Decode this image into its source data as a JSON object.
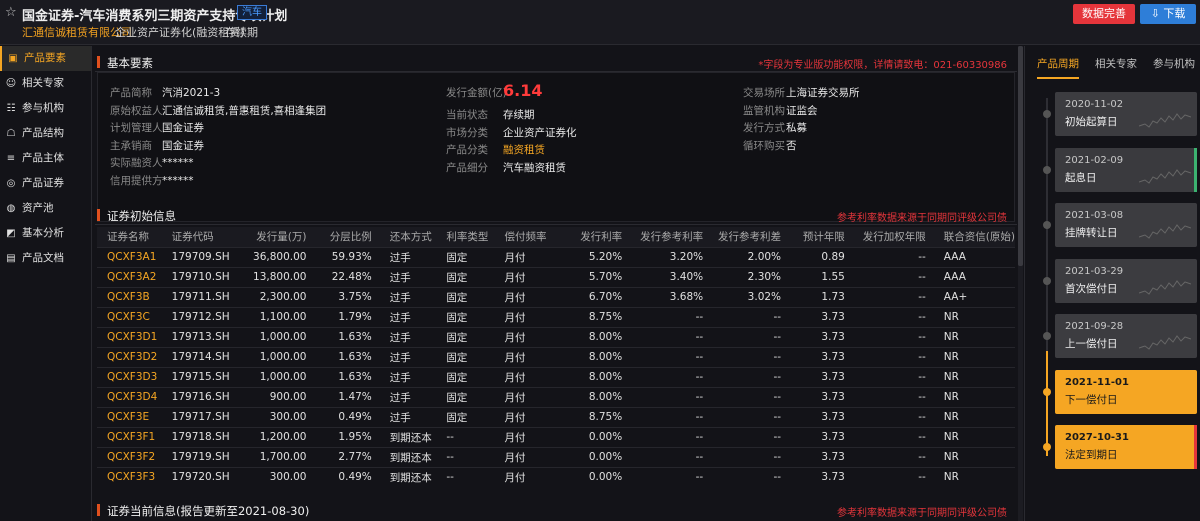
{
  "header": {
    "title": "国金证券-汽车消费系列三期资产支持专项计划",
    "tag": "汽车",
    "originator": "汇通信诚租赁有限公司",
    "type": "企业资产证券化(融资租赁)",
    "status": "存续期",
    "btn_data": "数据完善",
    "btn_download": "下载"
  },
  "sidebar": {
    "items": [
      {
        "label": "产品要素",
        "icon": "grid-icon"
      },
      {
        "label": "相关专家",
        "icon": "user-icon"
      },
      {
        "label": "参与机构",
        "icon": "people-icon"
      },
      {
        "label": "产品结构",
        "icon": "structure-icon"
      },
      {
        "label": "产品主体",
        "icon": "layers-icon"
      },
      {
        "label": "产品证券",
        "icon": "security-icon"
      },
      {
        "label": "资产池",
        "icon": "pool-icon"
      },
      {
        "label": "基本分析",
        "icon": "chart-icon"
      },
      {
        "label": "产品文档",
        "icon": "doc-icon"
      }
    ]
  },
  "basic": {
    "title": "基本要素",
    "note": "*字段为专业版功能权限，详情请致电：021-60330986",
    "col1": [
      {
        "k": "产品简称",
        "v": "汽消2021-3"
      },
      {
        "k": "原始权益人",
        "v": "汇通信诚租赁,普惠租赁,喜相逢集团"
      },
      {
        "k": "计划管理人",
        "v": "国金证券"
      },
      {
        "k": "主承销商",
        "v": "国金证券"
      },
      {
        "k": "实际融资人",
        "v": "******"
      },
      {
        "k": "信用提供方",
        "v": "******"
      }
    ],
    "col2": [
      {
        "k": "发行金额(亿)",
        "v": "6.14"
      },
      {
        "k": "当前状态",
        "v": "存续期"
      },
      {
        "k": "市场分类",
        "v": "企业资产证券化"
      },
      {
        "k": "产品分类",
        "v": "融资租赁"
      },
      {
        "k": "产品细分",
        "v": "汽车融资租赁"
      }
    ],
    "col3": [
      {
        "k": "交易场所",
        "v": "上海证券交易所"
      },
      {
        "k": "监管机构",
        "v": "证监会"
      },
      {
        "k": "发行方式",
        "v": "私募"
      },
      {
        "k": "循环购买",
        "v": "否"
      }
    ]
  },
  "securities": {
    "title": "证券初始信息",
    "note": "参考利率数据来源于同期同评级公司债",
    "headers": [
      "证券名称",
      "证券代码",
      "发行量(万)",
      "分层比例",
      "还本方式",
      "利率类型",
      "偿付频率",
      "发行利率",
      "发行参考利率",
      "发行参考利差",
      "预计年限",
      "发行加权年限",
      "联合资信(原始)"
    ],
    "rows": [
      [
        "QCXF3A1",
        "179709.SH",
        "36,800.00",
        "59.93%",
        "过手",
        "固定",
        "月付",
        "5.20%",
        "3.20%",
        "2.00%",
        "0.89",
        "--",
        "AAA"
      ],
      [
        "QCXF3A2",
        "179710.SH",
        "13,800.00",
        "22.48%",
        "过手",
        "固定",
        "月付",
        "5.70%",
        "3.40%",
        "2.30%",
        "1.55",
        "--",
        "AAA"
      ],
      [
        "QCXF3B",
        "179711.SH",
        "2,300.00",
        "3.75%",
        "过手",
        "固定",
        "月付",
        "6.70%",
        "3.68%",
        "3.02%",
        "1.73",
        "--",
        "AA+"
      ],
      [
        "QCXF3C",
        "179712.SH",
        "1,100.00",
        "1.79%",
        "过手",
        "固定",
        "月付",
        "8.75%",
        "--",
        "--",
        "3.73",
        "--",
        "NR"
      ],
      [
        "QCXF3D1",
        "179713.SH",
        "1,000.00",
        "1.63%",
        "过手",
        "固定",
        "月付",
        "8.00%",
        "--",
        "--",
        "3.73",
        "--",
        "NR"
      ],
      [
        "QCXF3D2",
        "179714.SH",
        "1,000.00",
        "1.63%",
        "过手",
        "固定",
        "月付",
        "8.00%",
        "--",
        "--",
        "3.73",
        "--",
        "NR"
      ],
      [
        "QCXF3D3",
        "179715.SH",
        "1,000.00",
        "1.63%",
        "过手",
        "固定",
        "月付",
        "8.00%",
        "--",
        "--",
        "3.73",
        "--",
        "NR"
      ],
      [
        "QCXF3D4",
        "179716.SH",
        "900.00",
        "1.47%",
        "过手",
        "固定",
        "月付",
        "8.00%",
        "--",
        "--",
        "3.73",
        "--",
        "NR"
      ],
      [
        "QCXF3E",
        "179717.SH",
        "300.00",
        "0.49%",
        "过手",
        "固定",
        "月付",
        "8.75%",
        "--",
        "--",
        "3.73",
        "--",
        "NR"
      ],
      [
        "QCXF3F1",
        "179718.SH",
        "1,200.00",
        "1.95%",
        "到期还本",
        "--",
        "月付",
        "0.00%",
        "--",
        "--",
        "3.73",
        "--",
        "NR"
      ],
      [
        "QCXF3F2",
        "179719.SH",
        "1,700.00",
        "2.77%",
        "到期还本",
        "--",
        "月付",
        "0.00%",
        "--",
        "--",
        "3.73",
        "--",
        "NR"
      ],
      [
        "QCXF3F3",
        "179720.SH",
        "300.00",
        "0.49%",
        "到期还本",
        "--",
        "月付",
        "0.00%",
        "--",
        "--",
        "3.73",
        "--",
        "NR"
      ]
    ]
  },
  "current": {
    "title": "证券当前信息(报告更新至2021-08-30)",
    "note": "参考利率数据来源于同期同评级公司债"
  },
  "right": {
    "tabs": [
      "产品周期",
      "相关专家",
      "参与机构"
    ],
    "timeline": [
      {
        "date": "2020-11-02",
        "label": "初始起算日",
        "state": "done"
      },
      {
        "date": "2021-02-09",
        "label": "起息日",
        "state": "current",
        "edge": "#3cb371"
      },
      {
        "date": "2021-03-08",
        "label": "挂牌转让日",
        "state": "done"
      },
      {
        "date": "2021-03-29",
        "label": "首次偿付日",
        "state": "done"
      },
      {
        "date": "2021-09-28",
        "label": "上一偿付日",
        "state": "done"
      },
      {
        "date": "2021-11-01",
        "label": "下一偿付日",
        "state": "next"
      },
      {
        "date": "2027-10-31",
        "label": "法定到期日",
        "state": "next",
        "edge": "#e5353b"
      }
    ]
  }
}
